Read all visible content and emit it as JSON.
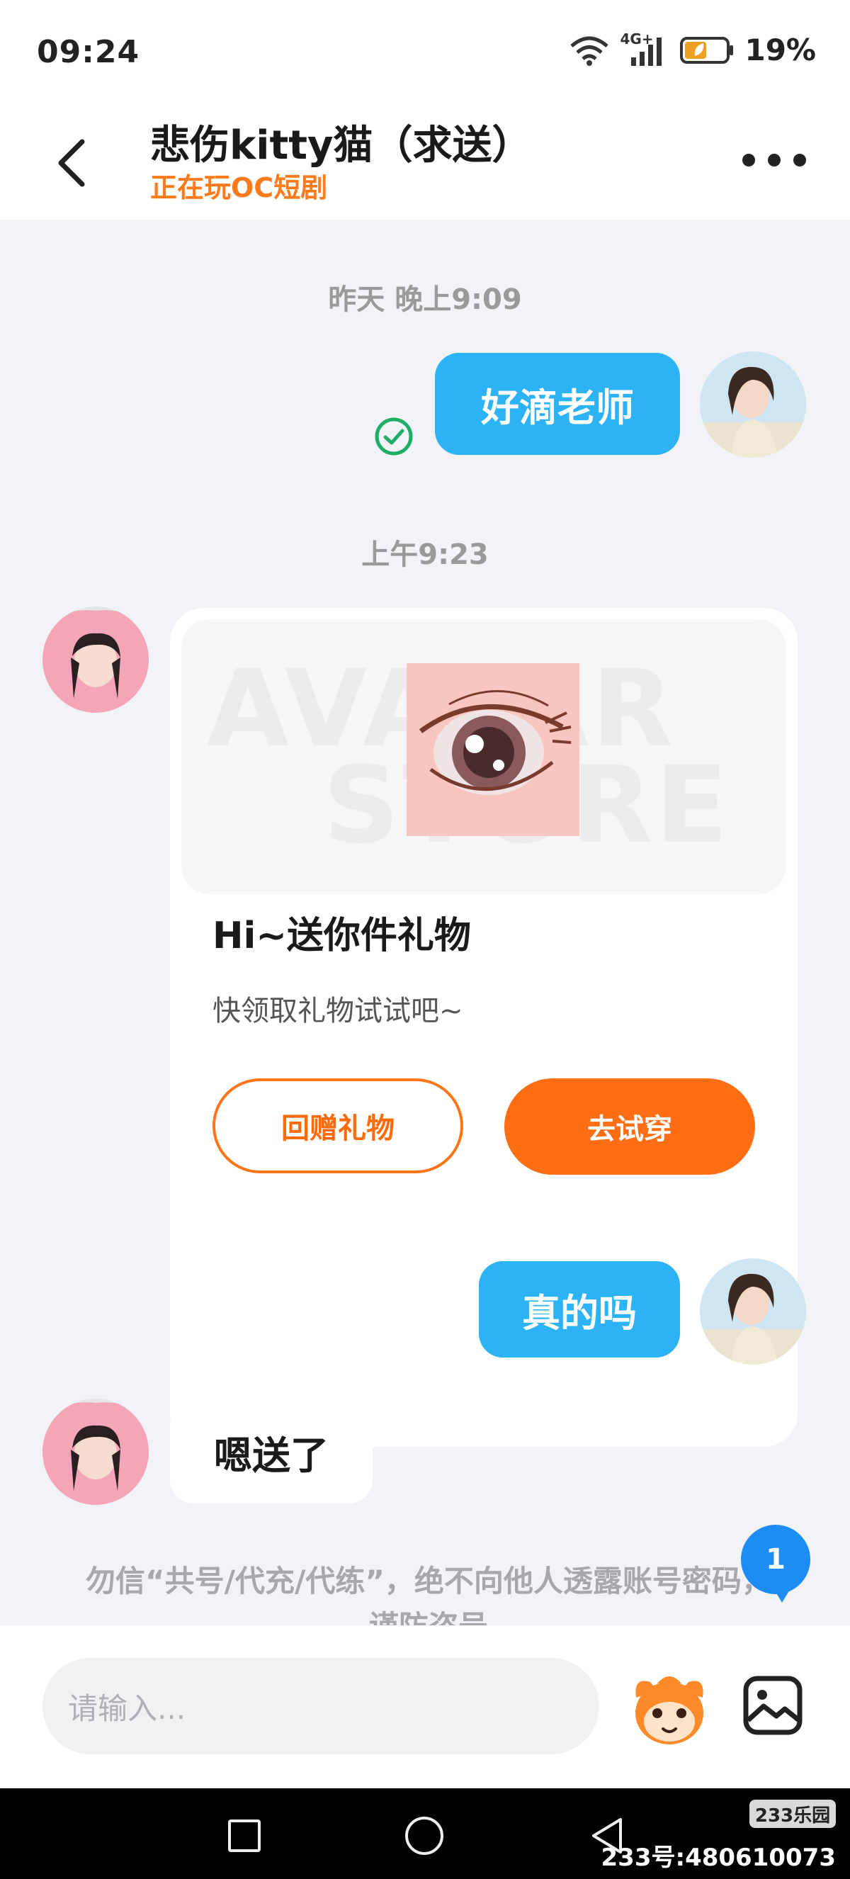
{
  "status_bar": {
    "time": "09:24",
    "network": "4G+",
    "battery_percent": "19%",
    "icons": [
      "wifi-icon",
      "signal-icon",
      "battery-icon"
    ]
  },
  "header": {
    "title": "悲伤kitty猫（求送）",
    "subtitle": "正在玩OC短剧",
    "accent_color": "#ff7a1a"
  },
  "messages": {
    "ts1": "昨天 晚上9:09",
    "out1": "好滴老师",
    "ts2": "上午9:23",
    "gift": {
      "title": "Hi~送你件礼物",
      "desc": "快领取礼物试试吧~",
      "btn_return": "回赠礼物",
      "btn_try": "去试穿",
      "watermark_line1": "AVATAR",
      "watermark_line2": "STORE"
    },
    "out2": "真的吗",
    "in1": "嗯送了"
  },
  "notice": "勿信“共号/代充/代练”，绝不向他人透露账号密码，谨防盗号",
  "unread_badge": "1",
  "input": {
    "placeholder": "请输入..."
  },
  "watermark": {
    "logo": "233乐园",
    "id_text": "233号:480610073"
  },
  "colors": {
    "bubble_out": "#2bb3f5",
    "button_orange": "#ff6e14",
    "badge_blue": "#1d8df5"
  }
}
